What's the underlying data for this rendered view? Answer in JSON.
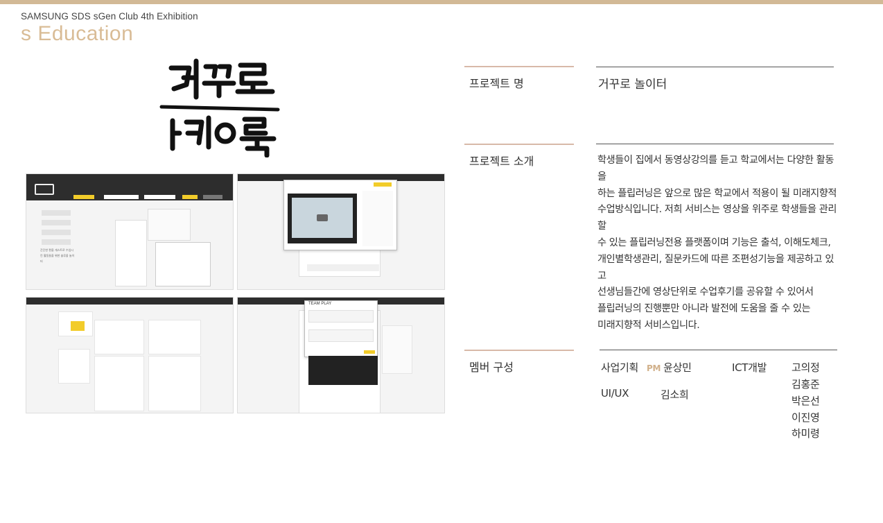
{
  "header": {
    "exhibition": "SAMSUNG SDS sGen Club 4th Exhibition",
    "category": "s Education"
  },
  "logo": {
    "line1": "거꾸로",
    "line2": "ㅏ캐ㅣ이룩"
  },
  "screenshots": [
    {
      "name": "main-page",
      "text": "간단한 편을 개스트로 수업시킨 활동들을 위한 솔루을 놀이터"
    },
    {
      "name": "video-page",
      "text": ""
    },
    {
      "name": "student-management-page",
      "text": ""
    },
    {
      "name": "team-play-page",
      "text": "TEAM PLAY"
    }
  ],
  "project": {
    "name_label": "프로젝트 명",
    "name_value": "거꾸로 놀이터",
    "intro_label": "프로젝트 소개",
    "intro_lines": [
      "학생들이 집에서 동영상강의를 듣고 학교에서는 다양한 활동을",
      "하는 플립러닝은 앞으로 많은 학교에서 적용이 될 미래지향적",
      "수업방식입니다. 저희 서비스는 영상을 위주로 학생들을 관리할",
      "수 있는 플립러닝전용 플랫폼이며 기능은 출석, 이해도체크,",
      "개인별학생관리, 질문카드에 따른 조편성기능을 제공하고 있고",
      "선생님들간에 영상단위로 수업후기를 공유할 수 있어서",
      "플립러닝의 진행뿐만 아니라 발전에 도움을 줄 수 있는",
      "미래지향적 서비스입니다."
    ],
    "members_label": "멤버 구성"
  },
  "members": {
    "business_role": "사업기획",
    "pm_badge": "PM",
    "business_name": "윤상민",
    "uiux_role": "UI/UX",
    "uiux_name": "김소희",
    "ict_role": "ICT개발",
    "ict_names": [
      "고의정",
      "김홍준",
      "박은선",
      "이진영",
      "하미령"
    ]
  },
  "colors": {
    "accent_bar": "#d2b996",
    "category": "#d9bc96",
    "label_line": "#d8b9a8",
    "pm_badge": "#d1b08a",
    "ui_yellow": "#f2cc2a",
    "ui_dark": "#2d2d2d"
  }
}
